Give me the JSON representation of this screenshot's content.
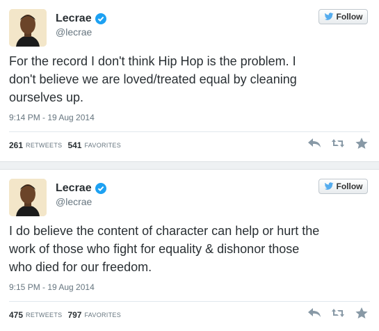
{
  "colors": {
    "verified": "#1da1f2",
    "follow_bird": "#55acee",
    "icon_gray": "#8899a6"
  },
  "tweets": [
    {
      "name": "Lecrae",
      "handle": "@lecrae",
      "follow_label": "Follow",
      "text_lines": [
        "For the record I don't think Hip Hop is the problem. I",
        "don't believe we are loved/treated equal by cleaning",
        "ourselves up."
      ],
      "timestamp": "9:14 PM - 19 Aug 2014",
      "retweets": "261",
      "retweets_label": "RETWEETS",
      "favorites": "541",
      "favorites_label": "FAVORITES"
    },
    {
      "name": "Lecrae",
      "handle": "@lecrae",
      "follow_label": "Follow",
      "text_lines": [
        "I do believe the content of character can help or hurt the",
        "work of those who fight for equality & dishonor those",
        "who died for our freedom."
      ],
      "timestamp": "9:15 PM - 19 Aug 2014",
      "retweets": "475",
      "retweets_label": "RETWEETS",
      "favorites": "797",
      "favorites_label": "FAVORITES"
    }
  ]
}
